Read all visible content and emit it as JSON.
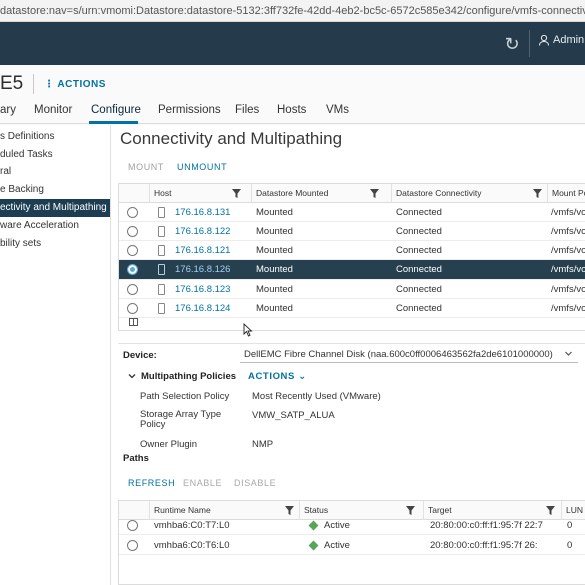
{
  "browser": {
    "url": "datastore:nav=s/urn:vmomi:Datastore:datastore-5132:3ff732fe-42dd-4eb2-bc5c-6572c585e342/configure/vmfs-connectivity"
  },
  "topbar": {
    "user": "Admin"
  },
  "object": {
    "name": "E5",
    "actions_label": "ACTIONS"
  },
  "tabs": [
    {
      "label": "ary"
    },
    {
      "label": "Monitor"
    },
    {
      "label": "Configure"
    },
    {
      "label": "Permissions"
    },
    {
      "label": "Files"
    },
    {
      "label": "Hosts"
    },
    {
      "label": "VMs"
    }
  ],
  "sidebar": {
    "items": [
      {
        "label": "s Definitions"
      },
      {
        "label": "duled Tasks"
      },
      {
        "label": "ral"
      },
      {
        "label": "e Backing"
      },
      {
        "label": "ectivity and Multipathing"
      },
      {
        "label": "ware Acceleration"
      },
      {
        "label": "bility sets"
      }
    ]
  },
  "main": {
    "title": "Connectivity and Multipathing",
    "mount_label": "MOUNT",
    "unmount_label": "UNMOUNT",
    "host_grid": {
      "columns": [
        "Host",
        "Datastore Mounted",
        "Datastore Connectivity",
        "Mount Po"
      ],
      "rows": [
        {
          "host": "176.16.8.131",
          "mounted": "Mounted",
          "connectivity": "Connected",
          "mount_point": "/vmfs/vo"
        },
        {
          "host": "176.16.8.122",
          "mounted": "Mounted",
          "connectivity": "Connected",
          "mount_point": "/vmfs/vo"
        },
        {
          "host": "176.16.8.121",
          "mounted": "Mounted",
          "connectivity": "Connected",
          "mount_point": "/vmfs/vo"
        },
        {
          "host": "176.16.8.126",
          "mounted": "Mounted",
          "connectivity": "Connected",
          "mount_point": "/vmfs/vo"
        },
        {
          "host": "176.16.8.123",
          "mounted": "Mounted",
          "connectivity": "Connected",
          "mount_point": "/vmfs/vo"
        },
        {
          "host": "176.16.8.124",
          "mounted": "Mounted",
          "connectivity": "Connected",
          "mount_point": "/vmfs/vo"
        }
      ]
    },
    "device": {
      "label": "Device:",
      "value": "DellEMC Fibre Channel Disk (naa.600c0ff0006463562fa2de6101000000)"
    },
    "multipathing": {
      "label": "Multipathing Policies",
      "actions_label": "ACTIONS",
      "path_selection_label": "Path Selection Policy",
      "path_selection_value": "Most Recently Used (VMware)",
      "storage_array_label": "Storage Array Type Policy",
      "storage_array_value": "VMW_SATP_ALUA",
      "owner_label": "Owner Plugin",
      "owner_value": "NMP"
    },
    "paths": {
      "label": "Paths",
      "refresh_label": "REFRESH",
      "enable_label": "ENABLE",
      "disable_label": "DISABLE",
      "columns": [
        "Runtime Name",
        "Status",
        "Target",
        "LUN"
      ],
      "rows": [
        {
          "runtime": "vmhba6:C0:T7:L0",
          "status": "Active",
          "target": "20:80:00:c0:ff:f1:95:7f 22:7",
          "lun": "0"
        },
        {
          "runtime": "vmhba6:C0:T6:L0",
          "status": "Active",
          "target": "20:80:00:c0:ff:f1:95:7f 26:",
          "lun": "0"
        }
      ]
    }
  },
  "colors": {
    "accent": "#0072a3",
    "header": "#253a4a",
    "selected_row": "#27404f",
    "active_status": "#5aa35a"
  }
}
